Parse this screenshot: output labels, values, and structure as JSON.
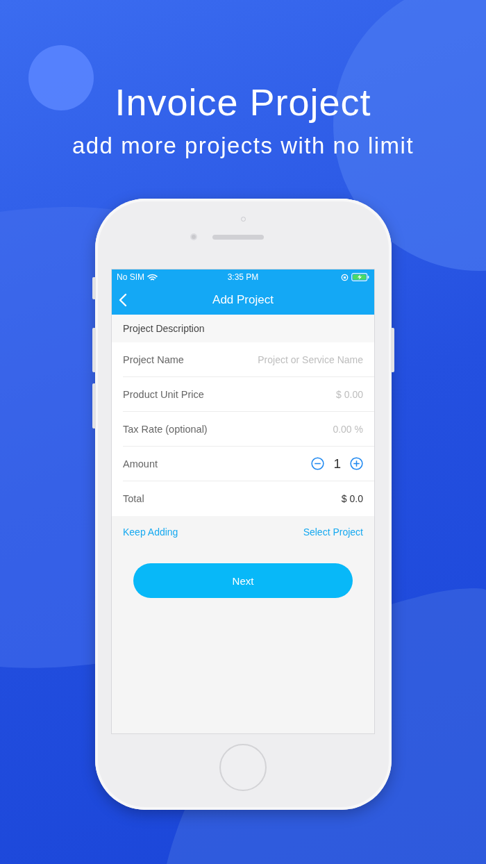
{
  "hero": {
    "title": "Invoice Project",
    "subtitle": "add more projects with no limit"
  },
  "status_bar": {
    "carrier": "No SIM",
    "time": "3:35 PM"
  },
  "nav": {
    "title": "Add Project"
  },
  "section": "Project Description",
  "rows": [
    {
      "kind": "input",
      "label": "Project Name",
      "placeholder": "Project or Service Name"
    },
    {
      "kind": "input",
      "label": "Product Unit Price",
      "placeholder": "$ 0.00"
    },
    {
      "kind": "input",
      "label": "Tax Rate (optional)",
      "placeholder": "0.00 %"
    },
    {
      "kind": "stepper",
      "label": "Amount",
      "value": "1"
    },
    {
      "kind": "value",
      "label": "Total",
      "value": "$ 0.0"
    }
  ],
  "links": [
    "Keep Adding",
    "Select Project"
  ],
  "primary_button": "Next"
}
